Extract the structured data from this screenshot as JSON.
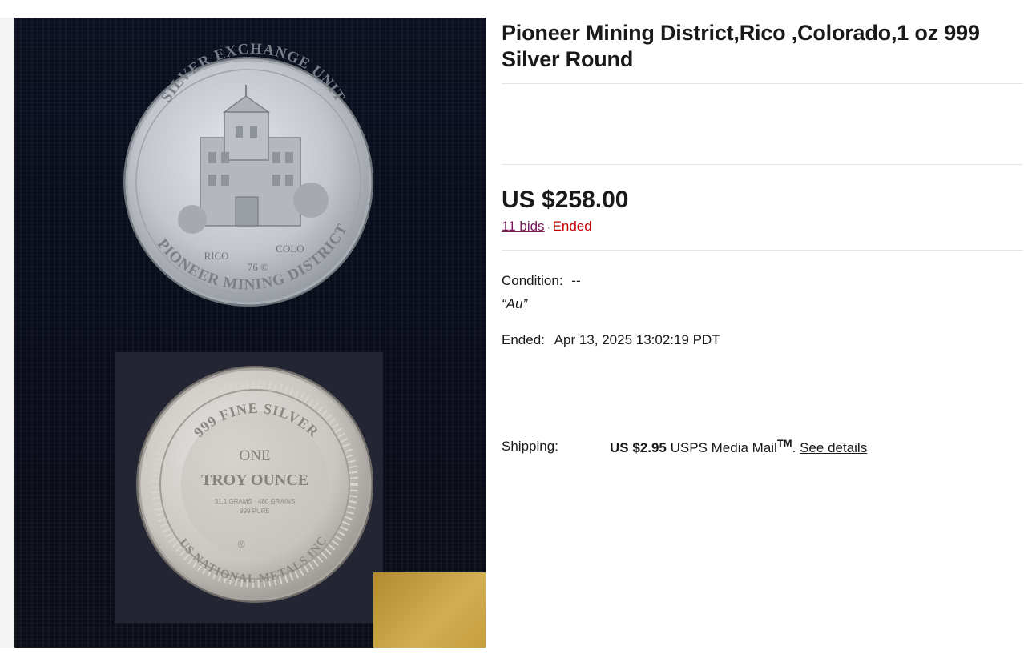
{
  "listing": {
    "title": "Pioneer Mining District,Rico ,Colorado,1 oz 999 Silver Round",
    "price": "US $258.00",
    "bids_label": "11 bids",
    "separator": "·",
    "status": "Ended",
    "condition_label": "Condition:",
    "condition_value": "--",
    "condition_note": "“Au”",
    "ended_label": "Ended:",
    "ended_value": "Apr 13, 2025 13:02:19 PDT",
    "shipping_label": "Shipping:",
    "shipping_price": "US $2.95",
    "shipping_service": "USPS Media Mail",
    "shipping_tm": "TM",
    "shipping_period": ".",
    "see_details": "See details"
  },
  "photo": {
    "obverse": {
      "top_legend": "SILVER EXCHANGE UNIT",
      "bottom_legend": "PIONEER MINING DISTRICT",
      "left_text": "RICO",
      "right_text": "COLO",
      "year_text": "76 ©"
    },
    "reverse": {
      "ring_legend": "999 FINE SILVER",
      "line1": "ONE",
      "line2": "TROY OUNCE",
      "small_line1": "31.1 GRAMS · 480 GRAINS",
      "small_line2": "999 PURE",
      "bottom_legend": "US NATIONAL METALS INC",
      "mark": "®"
    }
  },
  "colors": {
    "title": "#191919",
    "bids_link": "#7a1a5c",
    "ended": "#c40000",
    "divider": "#e5e5e5",
    "backdrop": "#0b0f1f"
  }
}
